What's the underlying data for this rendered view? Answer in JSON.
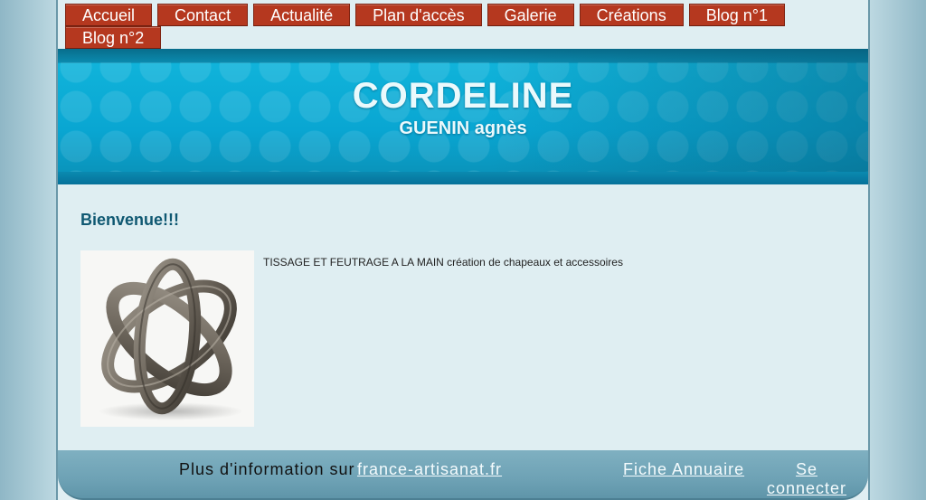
{
  "nav": {
    "items": [
      {
        "label": "Accueil"
      },
      {
        "label": "Contact"
      },
      {
        "label": "Actualité"
      },
      {
        "label": "Plan d'accès"
      },
      {
        "label": "Galerie"
      },
      {
        "label": "Créations"
      },
      {
        "label": "Blog n°1"
      },
      {
        "label": "Blog n°2"
      }
    ]
  },
  "header": {
    "title": "CORDELINE",
    "subtitle": "GUENIN agnès"
  },
  "main": {
    "heading": "Bienvenue!!!",
    "description": "TISSAGE ET FEUTRAGE A LA MAIN création de chapeaux et accessoires"
  },
  "footer": {
    "info_text": "Plus d'information sur",
    "artisanat_link": "france-artisanat.fr",
    "annuaire_link": "Fiche Annuaire",
    "connect_link": "Se connecter"
  },
  "colors": {
    "nav_button": "#b5381f",
    "header_blue": "#09a6d2",
    "heading": "#0f5872",
    "footer": "#6ea2b5"
  }
}
